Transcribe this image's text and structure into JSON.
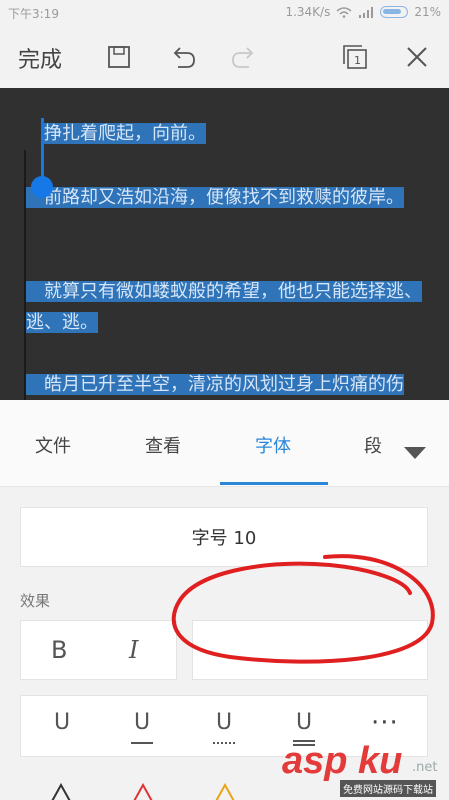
{
  "status_bar": {
    "time": "下午3:19",
    "speed": "1.34K/s",
    "battery": "21%"
  },
  "toolbar": {
    "done_label": "完成"
  },
  "document": {
    "paragraphs": [
      "挣扎着爬起，向前。",
      "前路却又浩如沿海，便像找不到救赎的彼岸。",
      "就算只有微如蝼蚁般的希望，他也只能选择逃、逃、逃。",
      "皓月已升至半空，清凉的风划过身上炽痛的伤口，似乎也不再那么难受。"
    ]
  },
  "tabs": [
    {
      "label": "文件"
    },
    {
      "label": "查看"
    },
    {
      "label": "字体",
      "active": true
    },
    {
      "label": "段"
    }
  ],
  "font_panel": {
    "font_size_label": "字号  10",
    "effects_label": "效果",
    "bold_label": "B",
    "italic_label": "I",
    "underline_label": "U",
    "more_label": "···"
  },
  "watermark": {
    "brand": "asp ku",
    "domain_tail": ".net",
    "tagline": "免费网站源码下载站"
  },
  "colors": {
    "accent": "#2a86d8",
    "selection": "#2f73b8",
    "doc_bg": "#303030",
    "annotation": "#e02020"
  }
}
